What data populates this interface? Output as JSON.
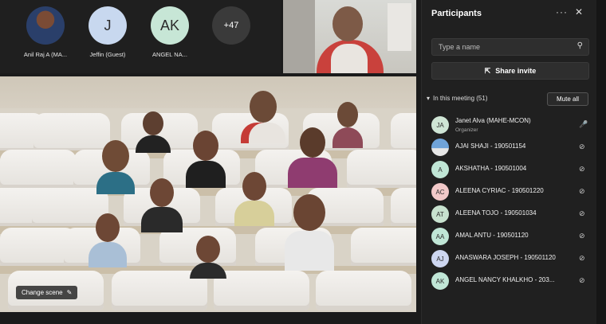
{
  "gallery": [
    {
      "initials": "",
      "name": "Anil Raj A (MA...",
      "bg": "#2a3f6a",
      "kind": "photo"
    },
    {
      "initials": "J",
      "name": "Jeffin (Guest)",
      "bg": "#c8d8ef"
    },
    {
      "initials": "AK",
      "name": "ANGEL NA...",
      "bg": "#c7e6d6"
    },
    {
      "initials": "+47",
      "name": "",
      "bg": "#3a3a3a"
    }
  ],
  "stage": {
    "change_scene_label": "Change scene"
  },
  "panel": {
    "title": "Participants",
    "more": "···",
    "close": "✕",
    "search_placeholder": "Type a name",
    "share_label": "Share invite",
    "section_label": "In this meeting (51)",
    "mute_all_label": "Mute all",
    "participants": [
      {
        "initials": "JA",
        "name": "Janet Alva (MAHE-MCON)",
        "role": "Organizer",
        "avatar": "#cfe5d5",
        "mic": "on"
      },
      {
        "initials": "",
        "name": "AJAI SHAJI - 190501154",
        "role": "",
        "avatar": "#8fb7e6",
        "mic": "off"
      },
      {
        "initials": "A",
        "name": "AKSHATHA - 190501004",
        "role": "",
        "avatar": "#c0e6d6",
        "mic": "off"
      },
      {
        "initials": "AC",
        "name": "ALEENA CYRIAC - 190501220",
        "role": "",
        "avatar": "#f2c9c9",
        "mic": "off"
      },
      {
        "initials": "AT",
        "name": "ALEENA TOJO - 190501034",
        "role": "",
        "avatar": "#c8e2cf",
        "mic": "off"
      },
      {
        "initials": "AA",
        "name": "AMAL ANTU - 190501120",
        "role": "",
        "avatar": "#c0e6d6",
        "mic": "off"
      },
      {
        "initials": "AJ",
        "name": "ANASWARA JOSEPH - 190501120",
        "role": "",
        "avatar": "#cdd6f0",
        "mic": "off"
      },
      {
        "initials": "AK",
        "name": "ANGEL NANCY KHALKHO - 203...",
        "role": "",
        "avatar": "#c0e6d6",
        "mic": "off"
      }
    ]
  }
}
